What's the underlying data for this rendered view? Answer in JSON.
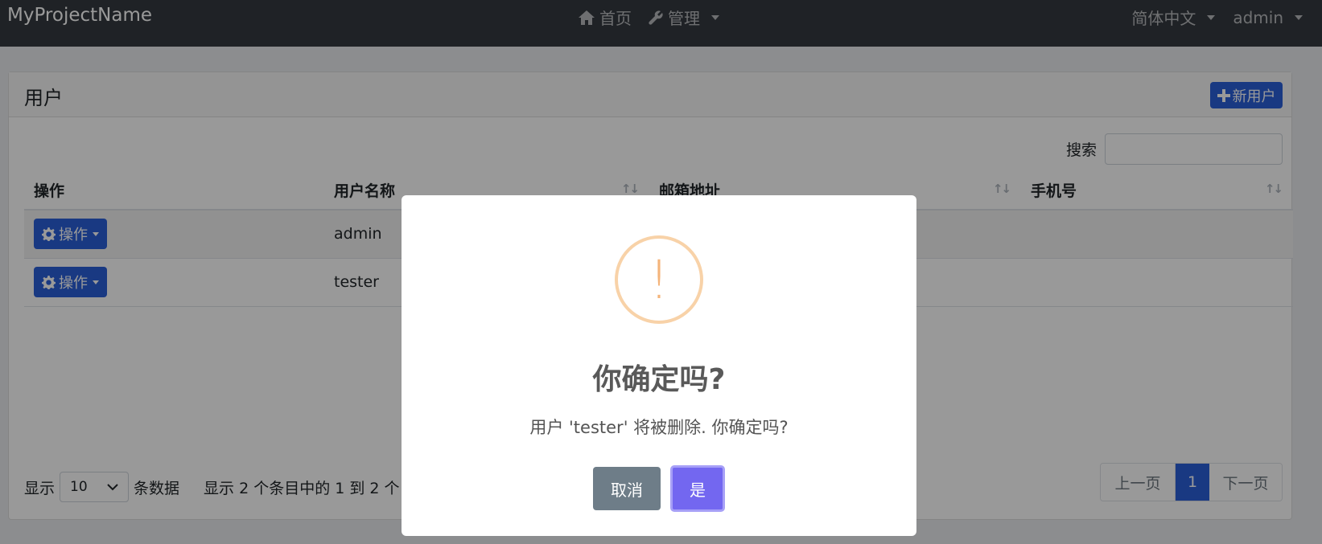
{
  "navbar": {
    "brand": "MyProjectName",
    "home_label": "首页",
    "manage_label": "管理",
    "language_label": "简体中文",
    "user_label": "admin"
  },
  "card": {
    "title": "用户",
    "new_user_label": "新用户",
    "search_label": "搜索",
    "search_value": ""
  },
  "table": {
    "headers": [
      "操作",
      "用户名称",
      "邮箱地址",
      "手机号"
    ],
    "rows": [
      {
        "action_label": "操作",
        "username": "admin",
        "email": "",
        "phone": ""
      },
      {
        "action_label": "操作",
        "username": "tester",
        "email": "",
        "phone": ""
      }
    ]
  },
  "footer": {
    "show_label": "显示",
    "page_size": "10",
    "entries_label": "条数据",
    "info_text": "显示 2 个条目中的 1 到 2 个",
    "prev_label": "上一页",
    "current_page": "1",
    "next_label": "下一页"
  },
  "dialog": {
    "icon": "!",
    "title": "你确定吗?",
    "message": "用户 'tester' 将被删除. 你确定吗?",
    "cancel_label": "取消",
    "confirm_label": "是"
  },
  "colors": {
    "navbar": "#343a40",
    "primary": "#2b5fd9",
    "confirm": "#7367f0",
    "cancel": "#6e7d88",
    "warning_icon": "#f8d2a8"
  }
}
